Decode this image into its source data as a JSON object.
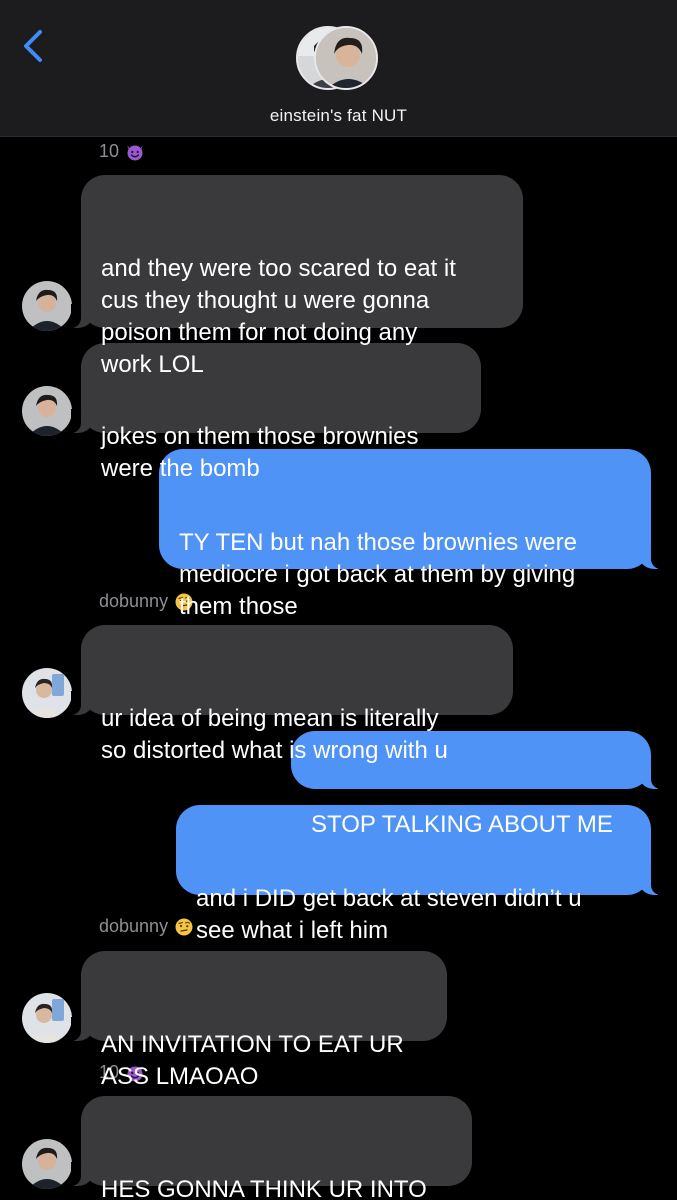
{
  "header": {
    "back_icon": "chevron-left-icon",
    "title": "einstein's fat NUT"
  },
  "colors": {
    "incoming_bubble": "#3a3a3c",
    "outgoing_bubble": "#4e93f5",
    "accent": "#3e8cf6"
  },
  "messages": [
    {
      "type": "sender",
      "name": "10",
      "emoji": "smiling-imp-emoji"
    },
    {
      "type": "incoming",
      "text": "and they were too scared to eat it\ncus they thought u were gonna\npoison them for not doing any\nwork LOL"
    },
    {
      "type": "incoming",
      "text": "jokes on them those brownies\nwere the bomb"
    },
    {
      "type": "outgoing",
      "text": "TY TEN but nah those brownies were\nmediocre i got back at them by giving\nthem those"
    },
    {
      "type": "sender",
      "name": "dobunny",
      "emoji": "raised-eyebrow-emoji"
    },
    {
      "type": "incoming",
      "text": "ur idea of being mean is literally\nso distorted what is wrong with u"
    },
    {
      "type": "outgoing",
      "text": "STOP TALKING ABOUT ME"
    },
    {
      "type": "outgoing",
      "text": "and i DID get back at steven didn’t u\nsee what i left him"
    },
    {
      "type": "sender",
      "name": "dobunny",
      "emoji": "raised-eyebrow-emoji"
    },
    {
      "type": "incoming",
      "text": "AN INVITATION TO EAT UR\nASS LMAOAO"
    },
    {
      "type": "sender",
      "name": "10",
      "emoji": "smiling-imp-emoji"
    },
    {
      "type": "incoming",
      "text": "HES GONNA THINK UR INTO\nHIM LOL"
    }
  ]
}
